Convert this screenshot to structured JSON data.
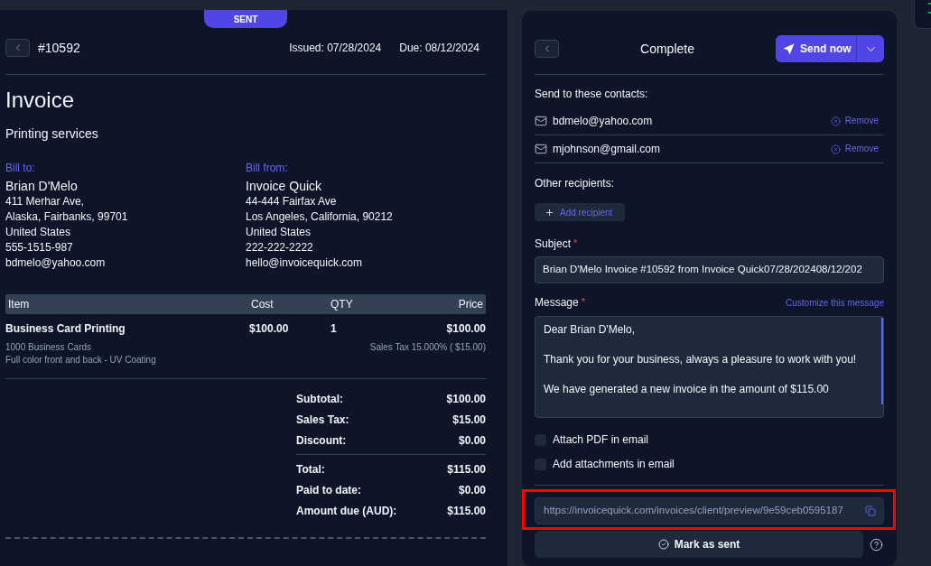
{
  "invoice": {
    "status": "SENT",
    "number": "#10592",
    "issued": "Issued: 07/28/2024",
    "due": "Due: 08/12/2024",
    "title": "Invoice",
    "description": "Printing services",
    "bill_to": {
      "label": "Bill to:",
      "name": "Brian D'Melo",
      "lines": [
        "411 Merhar Ave,",
        "Alaska, Fairbanks, 99701",
        "United States",
        "555-1515-987",
        "bdmelo@yahoo.com"
      ]
    },
    "bill_from": {
      "label": "Bill from:",
      "name": "Invoice Quick",
      "lines": [
        "44-444 Fairfax Ave",
        "Los Angeles, California, 90212",
        "United States",
        "222-222-2222",
        "hello@invoicequick.com"
      ]
    },
    "table": {
      "columns": [
        "Item",
        "Cost",
        "QTY",
        "Price"
      ],
      "rows": [
        {
          "cells": [
            "Business Card Printing",
            "$100.00",
            "1",
            "$100.00"
          ],
          "details": [
            "1000 Business Cards",
            "Full color front and back - UV Coating"
          ],
          "tax_note": "Sales Tax 15.000% ( $15.00)"
        }
      ]
    },
    "totals": [
      [
        {
          "label": "Subtotal:",
          "value": "$100.00"
        },
        {
          "label": "Sales Tax:",
          "value": "$15.00"
        },
        {
          "label": "Discount:",
          "value": "$0.00"
        }
      ],
      [
        {
          "label": "Total:",
          "value": "$115.00"
        },
        {
          "label": "Paid to date:",
          "value": "$0.00"
        },
        {
          "label": "Amount due (AUD):",
          "value": "$115.00"
        }
      ]
    ]
  },
  "send_panel": {
    "title": "Complete",
    "send_button": "Send now",
    "contacts_label": "Send to these contacts:",
    "contacts": [
      {
        "email": "bdmelo@yahoo.com",
        "remove": "Remove"
      },
      {
        "email": "mjohnson@gmail.com",
        "remove": "Remove"
      }
    ],
    "other_label": "Other recipients:",
    "add_recipient": "Add recipient",
    "subject": {
      "label": "Subject",
      "required_mark": "*",
      "value": "Brian D'Melo Invoice #10592 from Invoice Quick07/28/202408/12/202"
    },
    "message": {
      "label": "Message",
      "required_mark": "*",
      "link": "Customize this message",
      "paragraphs": [
        "Dear Brian D'Melo,",
        "Thank you for your business, always a pleasure to work with you!",
        "We have generated a new invoice in the amount of $115.00"
      ]
    },
    "options": [
      {
        "label": "Attach PDF in email",
        "checked": false
      },
      {
        "label": "Add attachments in email",
        "checked": false
      }
    ],
    "link_field": {
      "value": "https://invoicequick.com/invoices/client/preview/9e59ceb0595187"
    },
    "mark_sent_button": "Mark as sent"
  }
}
